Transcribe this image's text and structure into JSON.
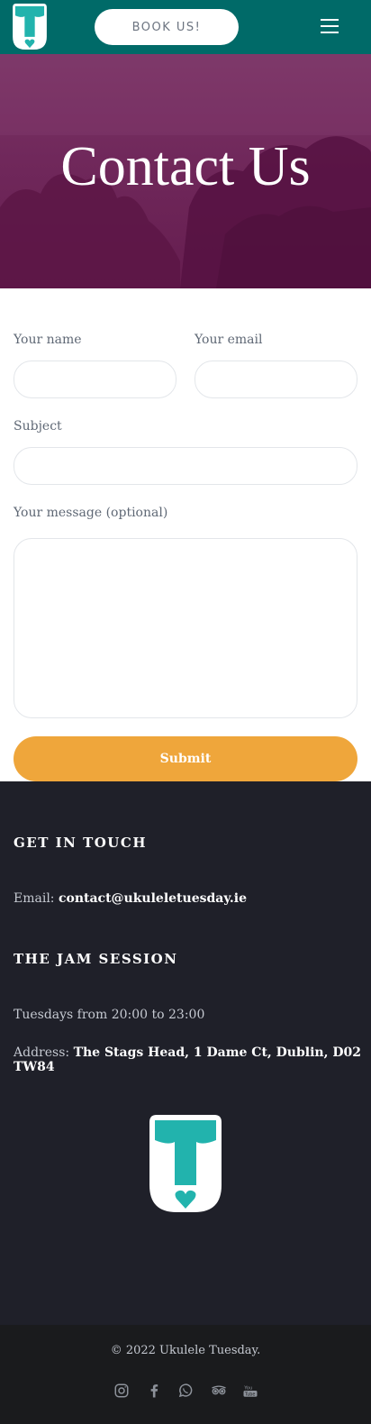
{
  "header": {
    "book_label": "BOOK US!",
    "logo_icon": "ukulele-tuesday-logo-icon",
    "menu_icon": "hamburger-menu-icon",
    "colors": {
      "bar": "#006a68",
      "logo": "#22b3ad"
    }
  },
  "hero": {
    "title": "Contact Us"
  },
  "form": {
    "name_label": "Your name",
    "email_label": "Your email",
    "subject_label": "Subject",
    "message_label": "Your message (optional)",
    "name_value": "",
    "email_value": "",
    "subject_value": "",
    "message_value": "",
    "submit_label": "Submit",
    "colors": {
      "submit": "#efa63b"
    }
  },
  "footer": {
    "get_in_touch_heading": "GET IN TOUCH",
    "email_label": "Email:",
    "email_value": "contact@ukuleletuesday.ie",
    "jam_heading": "THE JAM SESSION",
    "schedule": "Tuesdays from 20:00 to 23:00",
    "address_label": "Address:",
    "address_value": "The Stags Head, 1 Dame Ct, Dublin, D02 TW84",
    "copyright": "© 2022 Ukulele Tuesday.",
    "social": [
      "instagram-icon",
      "facebook-icon",
      "whatsapp-icon",
      "tripadvisor-icon",
      "youtube-icon"
    ]
  }
}
